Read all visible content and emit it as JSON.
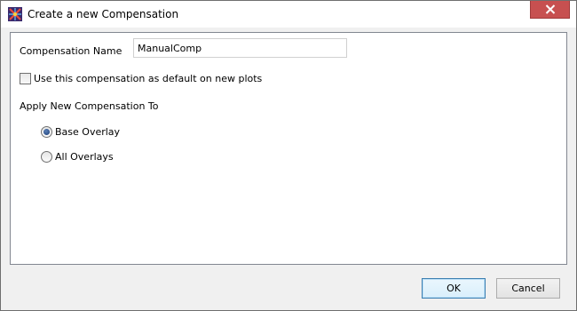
{
  "window": {
    "title": "Create a new Compensation",
    "close_icon": "close-x",
    "app_icon": "fcs-express-logo"
  },
  "form": {
    "name_label": "Compensation Name",
    "name_value": "ManualComp",
    "default_checkbox_label": "Use this compensation as default on new plots",
    "default_checked": false,
    "apply_label": "Apply New Compensation To",
    "options": [
      {
        "label": "Base Overlay",
        "selected": true
      },
      {
        "label": "All Overlays",
        "selected": false
      }
    ]
  },
  "buttons": {
    "ok_label": "OK",
    "cancel_label": "Cancel"
  },
  "colors": {
    "close_button": "#c75050",
    "default_button_border": "#3c7fb1",
    "radio_dot": "#1c3f7a"
  }
}
